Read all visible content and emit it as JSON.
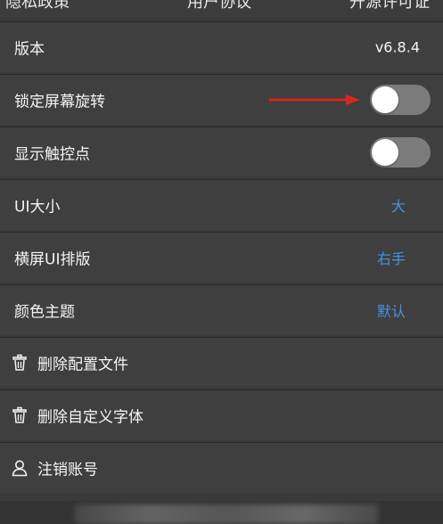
{
  "top_tabs": [
    "隐私政策",
    "用户协议",
    "开源许可证"
  ],
  "rows": {
    "version": {
      "label": "版本",
      "value": "v6.8.4"
    },
    "lock_rotation": {
      "label": "锁定屏幕旋转",
      "on": false
    },
    "show_touch": {
      "label": "显示触控点",
      "on": false
    },
    "ui_size": {
      "label": "UI大小",
      "value": "大"
    },
    "landscape_layout": {
      "label": "横屏UI排版",
      "value": "右手"
    },
    "color_theme": {
      "label": "颜色主题",
      "value": "默认"
    },
    "delete_config": {
      "label": "删除配置文件",
      "icon": "trash-icon"
    },
    "delete_font": {
      "label": "删除自定义字体",
      "icon": "trash-icon"
    },
    "logout_account": {
      "label": "注销账号",
      "icon": "user-icon"
    }
  },
  "colors": {
    "accent": "#4a90e2",
    "arrow": "#d9261c",
    "toggle_track": "#7b7b7b"
  }
}
